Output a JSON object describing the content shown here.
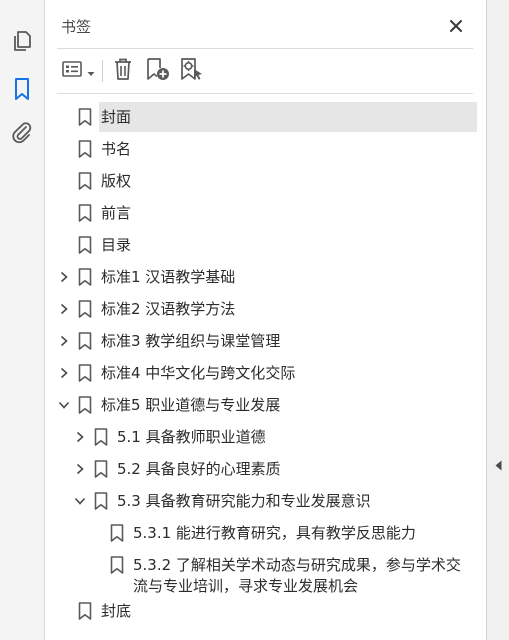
{
  "panel": {
    "title": "书签"
  },
  "leftbar": {
    "items": [
      {
        "name": "pages-icon"
      },
      {
        "name": "bookmark-icon",
        "active": true
      },
      {
        "name": "attachment-icon"
      }
    ]
  },
  "toolbar": {
    "buttons": [
      "options-menu",
      "delete-bookmark",
      "new-bookmark",
      "new-bookmark-from-structure"
    ]
  },
  "bookmarks": [
    {
      "label": "封面",
      "level": 0,
      "expander": "none",
      "selected": true
    },
    {
      "label": "书名",
      "level": 0,
      "expander": "none"
    },
    {
      "label": "版权",
      "level": 0,
      "expander": "none"
    },
    {
      "label": "前言",
      "level": 0,
      "expander": "none"
    },
    {
      "label": "目录",
      "level": 0,
      "expander": "none"
    },
    {
      "label": "标准1 汉语教学基础",
      "level": 0,
      "expander": "collapsed"
    },
    {
      "label": "标准2 汉语教学方法",
      "level": 0,
      "expander": "collapsed"
    },
    {
      "label": "标准3 教学组织与课堂管理",
      "level": 0,
      "expander": "collapsed"
    },
    {
      "label": "标准4 中华文化与跨文化交际",
      "level": 0,
      "expander": "collapsed"
    },
    {
      "label": "标准5 职业道德与专业发展",
      "level": 0,
      "expander": "expanded"
    },
    {
      "label": "5.1 具备教师职业道德",
      "level": 1,
      "expander": "collapsed"
    },
    {
      "label": "5.2 具备良好的心理素质",
      "level": 1,
      "expander": "collapsed"
    },
    {
      "label": "5.3 具备教育研究能力和专业发展意识",
      "level": 1,
      "expander": "expanded"
    },
    {
      "label": "5.3.1 能进行教育研究，具有教学反思能力",
      "level": 2,
      "expander": "none"
    },
    {
      "label": "5.3.2 了解相关学术动态与研究成果，参与学术交流与专业培训，寻求专业发展机会",
      "level": 2,
      "expander": "none",
      "wrap": true
    },
    {
      "label": "封底",
      "level": 0,
      "expander": "none"
    }
  ],
  "colors": {
    "accent": "#1473e6",
    "icon": "#5a5a5a",
    "selected_bg": "#e6e6e6"
  }
}
